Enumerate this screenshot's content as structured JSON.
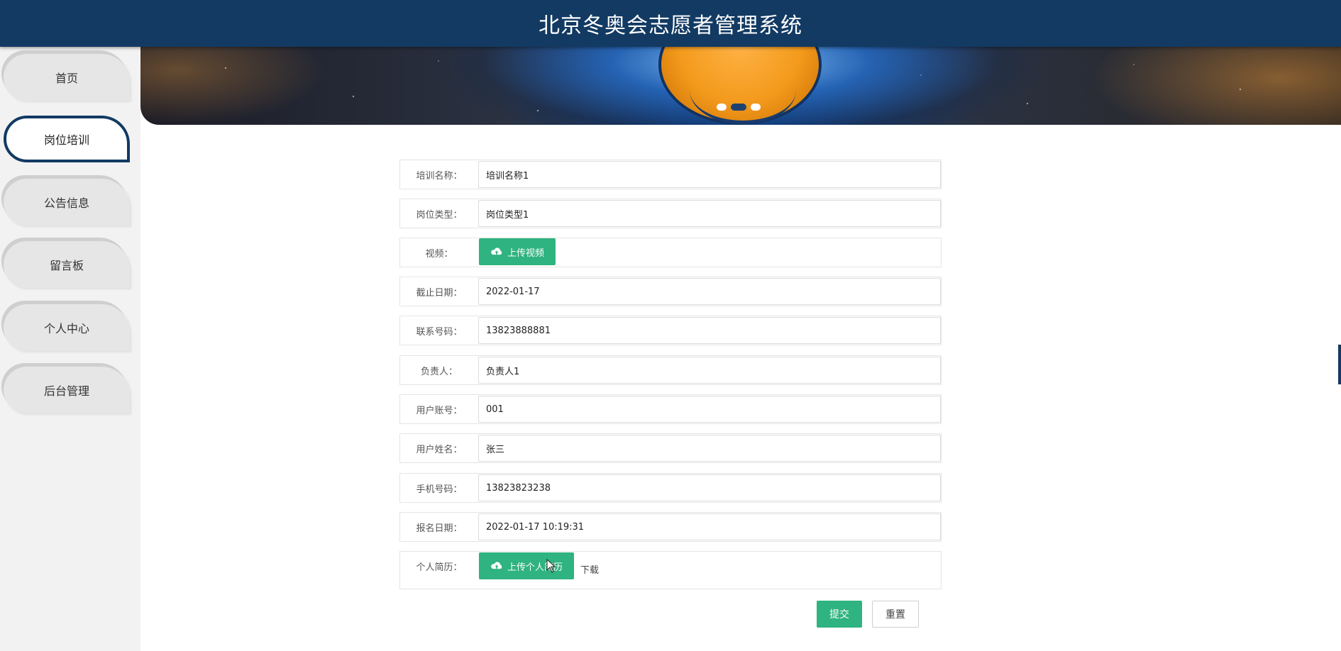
{
  "header": {
    "title": "北京冬奥会志愿者管理系统"
  },
  "sidebar": {
    "items": [
      {
        "label": "首页",
        "active": false
      },
      {
        "label": "岗位培训",
        "active": true
      },
      {
        "label": "公告信息",
        "active": false
      },
      {
        "label": "留言板",
        "active": false
      },
      {
        "label": "个人中心",
        "active": false
      },
      {
        "label": "后台管理",
        "active": false
      }
    ]
  },
  "banner": {
    "dots": 3,
    "active_dot": 2
  },
  "form": {
    "training_name": {
      "label": "培训名称：",
      "value": "培训名称1"
    },
    "position_type": {
      "label": "岗位类型：",
      "value": "岗位类型1"
    },
    "video": {
      "label": "视频：",
      "button": "上传视频"
    },
    "deadline": {
      "label": "截止日期：",
      "value": "2022-01-17"
    },
    "contact": {
      "label": "联系号码：",
      "value": "13823888881"
    },
    "manager": {
      "label": "负责人：",
      "value": "负责人1"
    },
    "account": {
      "label": "用户账号：",
      "value": "001"
    },
    "username": {
      "label": "用户姓名：",
      "value": "张三"
    },
    "mobile": {
      "label": "手机号码：",
      "value": "13823823238"
    },
    "signup_date": {
      "label": "报名日期：",
      "value": "2022-01-17 10:19:31"
    },
    "resume": {
      "label": "个人简历：",
      "button": "上传个人简历",
      "download": "下载"
    }
  },
  "actions": {
    "submit": "提交",
    "reset": "重置"
  },
  "colors": {
    "header": "#123a63",
    "accent": "#2fb380"
  }
}
